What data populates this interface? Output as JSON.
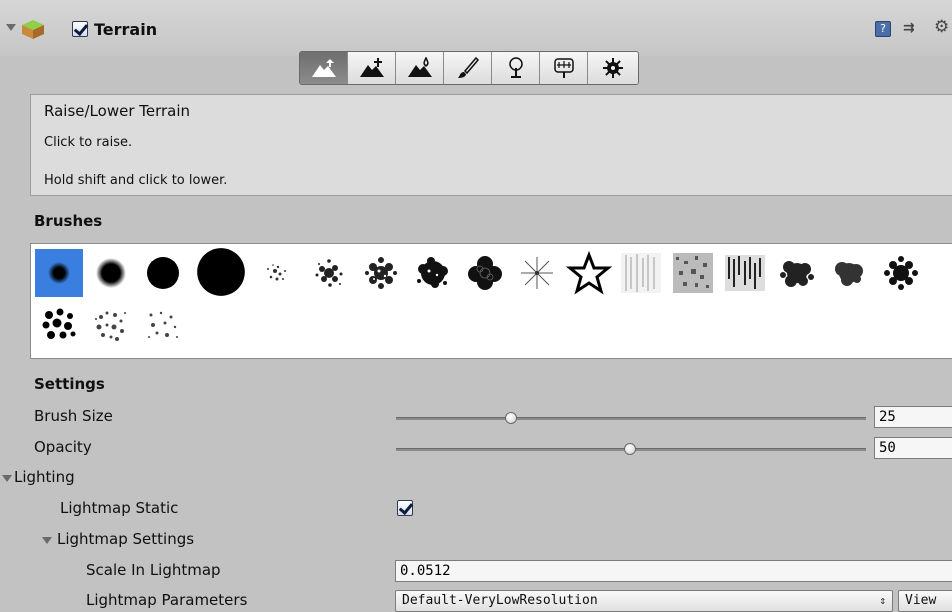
{
  "component": {
    "title": "Terrain",
    "enabled": true,
    "icons": [
      "help-icon",
      "preset-icon",
      "gear-icon"
    ]
  },
  "tools": [
    {
      "name": "raise-lower-terrain",
      "icon": "mountain-up-icon",
      "active": true
    },
    {
      "name": "paint-height",
      "icon": "mountain-plus-icon",
      "active": false
    },
    {
      "name": "smooth-height",
      "icon": "mountain-drop-icon",
      "active": false
    },
    {
      "name": "paint-texture",
      "icon": "brush-icon",
      "active": false
    },
    {
      "name": "place-trees",
      "icon": "tree-icon",
      "active": false
    },
    {
      "name": "paint-details",
      "icon": "grass-icon",
      "active": false
    },
    {
      "name": "terrain-settings",
      "icon": "gear-icon",
      "active": false
    }
  ],
  "tool_description": {
    "title": "Raise/Lower Terrain",
    "line1": "Click to raise.",
    "line2": "Hold shift and click to lower."
  },
  "brushes": {
    "heading": "Brushes",
    "selected_index": 0,
    "items": [
      "soft-round-small",
      "soft-round",
      "hard-round-medium",
      "hard-round-large",
      "spray-small",
      "spray-medium",
      "spray-large",
      "splatter-round",
      "flower-blob",
      "star-burst",
      "star-outline",
      "noise-vertical",
      "noise-square",
      "noise-streaks",
      "cloud-blob",
      "cloud-blob-2",
      "leaf-splat",
      "dots-cluster",
      "speckle-cluster",
      "speckle-sparse"
    ]
  },
  "settings": {
    "heading": "Settings",
    "brush_size": {
      "label": "Brush Size",
      "value": "25",
      "fraction": 0.25
    },
    "opacity": {
      "label": "Opacity",
      "value": "50",
      "fraction": 0.5
    }
  },
  "lighting": {
    "label": "Lighting",
    "lightmap_static": {
      "label": "Lightmap Static",
      "checked": true
    },
    "lightmap_settings": {
      "label": "Lightmap Settings"
    },
    "scale_in_lightmap": {
      "label": "Scale In Lightmap",
      "value": "0.0512"
    },
    "lightmap_parameters": {
      "label": "Lightmap Parameters",
      "value": "Default-VeryLowResolution",
      "view_label": "View"
    }
  }
}
